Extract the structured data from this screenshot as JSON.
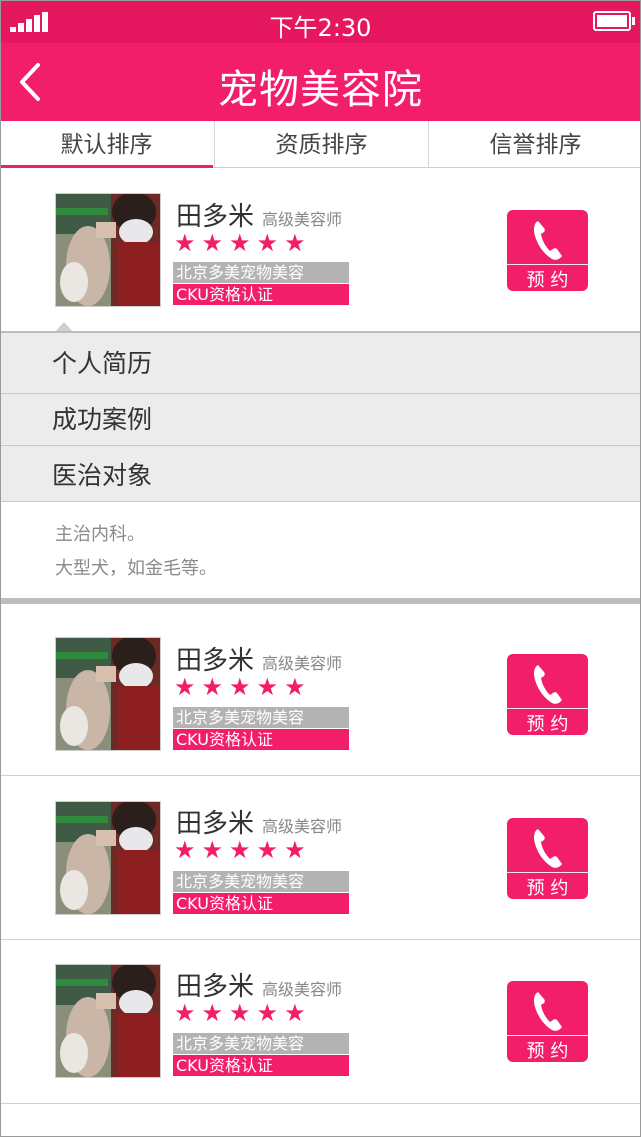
{
  "status": {
    "time": "下午2:30"
  },
  "header": {
    "title": "宠物美容院"
  },
  "tabs": [
    {
      "label": "默认排序"
    },
    {
      "label": "资质排序"
    },
    {
      "label": "信誉排序"
    }
  ],
  "groomers": [
    {
      "name": "田多米",
      "level": "高级美容师",
      "stars": "★★★★★",
      "shop": "北京多美宠物美容",
      "cert": "CKU资格认证",
      "call_label": "预 约"
    },
    {
      "name": "田多米",
      "level": "高级美容师",
      "stars": "★★★★★",
      "shop": "北京多美宠物美容",
      "cert": "CKU资格认证",
      "call_label": "预 约"
    },
    {
      "name": "田多米",
      "level": "高级美容师",
      "stars": "★★★★★",
      "shop": "北京多美宠物美容",
      "cert": "CKU资格认证",
      "call_label": "预 约"
    },
    {
      "name": "田多米",
      "level": "高级美容师",
      "stars": "★★★★★",
      "shop": "北京多美宠物美容",
      "cert": "CKU资格认证",
      "call_label": "预 约"
    }
  ],
  "detail_menu": [
    {
      "label": "个人简历"
    },
    {
      "label": "成功案例"
    },
    {
      "label": "医治对象"
    }
  ],
  "detail_text": [
    "主治内科。",
    "大型犬，如金毛等。"
  ],
  "colors": {
    "accent": "#f21e69",
    "status_bar": "#e5175f"
  },
  "icons": {
    "back": "chevron-left-icon",
    "phone": "phone-icon",
    "signal": "signal-icon",
    "battery": "battery-icon"
  }
}
